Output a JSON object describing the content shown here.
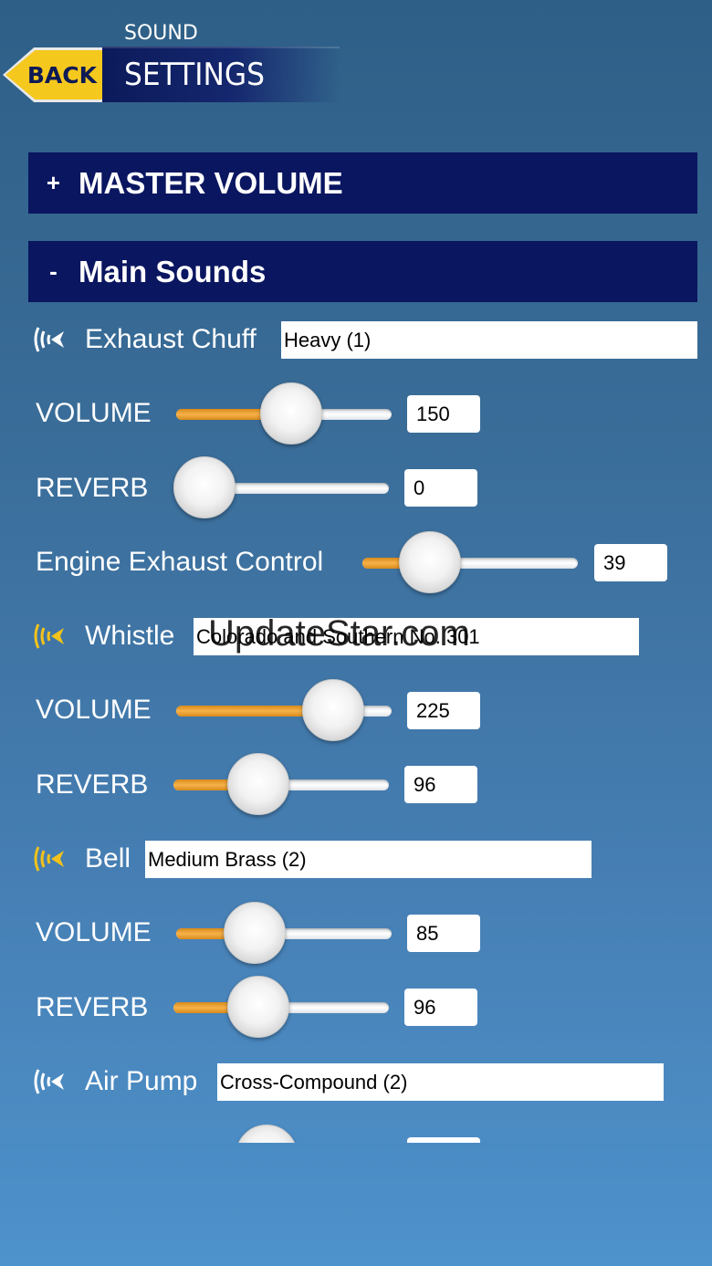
{
  "header": {
    "back_label": "BACK",
    "title_sub": "SOUND",
    "title_main": "SETTINGS"
  },
  "sections": {
    "master": {
      "toggle": "+",
      "label": "MASTER VOLUME"
    },
    "main": {
      "toggle": "-",
      "label": "Main Sounds"
    }
  },
  "sounds": {
    "exhaust": {
      "name": "Exhaust Chuff",
      "selection": "Heavy (1)",
      "icon_color": "#ffffff",
      "volume_label": "VOLUME",
      "volume": "150",
      "volume_fraction": 0.55,
      "reverb_label": "REVERB",
      "reverb": "0",
      "reverb_fraction": 0.0,
      "engine_label": "Engine Exhaust Control",
      "engine": "39",
      "engine_fraction": 0.24
    },
    "whistle": {
      "name": "Whistle",
      "selection": "Colorado and Southern No. 301",
      "icon_color": "#f2c21b",
      "volume_label": "VOLUME",
      "volume": "225",
      "volume_fraction": 0.82,
      "reverb_label": "REVERB",
      "reverb": "96",
      "reverb_fraction": 0.35
    },
    "bell": {
      "name": "Bell",
      "selection": "Medium Brass (2)",
      "icon_color": "#f2c21b",
      "volume_label": "VOLUME",
      "volume": "85",
      "volume_fraction": 0.31,
      "reverb_label": "REVERB",
      "reverb": "96",
      "reverb_fraction": 0.35
    },
    "airpump": {
      "name": "Air Pump",
      "selection": "Cross-Compound (2)",
      "icon_color": "#ffffff"
    }
  },
  "watermark": "UpdateStar.com",
  "colors": {
    "section_bar": "#0a1660",
    "slider_fill": "#f6b24a",
    "back_button": "#f5c81e"
  }
}
